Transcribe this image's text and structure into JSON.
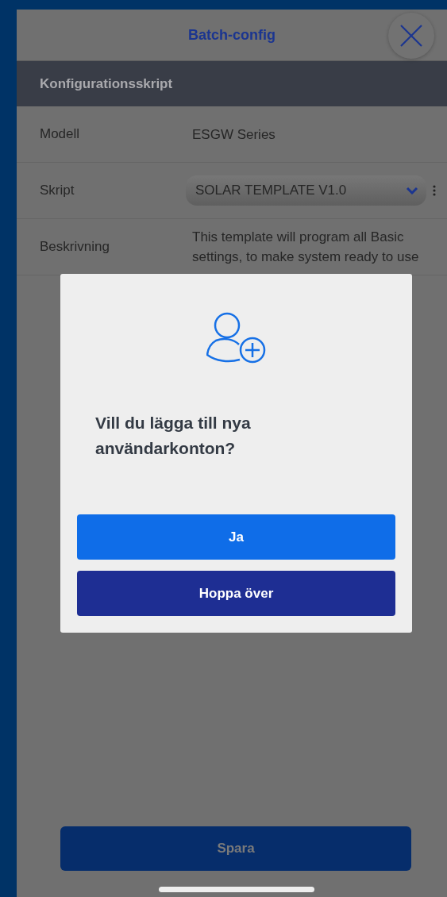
{
  "header": {
    "title": "Batch-config"
  },
  "section": {
    "title": "Konfigurationsskript"
  },
  "rows": [
    {
      "kind": "text",
      "label": "Modell",
      "value": "ESGW Series"
    },
    {
      "kind": "dropdown",
      "label": "Skript",
      "value": "SOLAR TEMPLATE V1.0"
    },
    {
      "kind": "text",
      "label": "Beskrivning",
      "value": "This template will program all Basic settings, to make system ready to use"
    }
  ],
  "save_button": "Spara",
  "dialog": {
    "question": "Vill du lägga till nya användarkonton?",
    "buttons": [
      {
        "kind": "primary",
        "label": "Ja"
      },
      {
        "kind": "secondary",
        "label": "Hoppa över"
      }
    ]
  }
}
